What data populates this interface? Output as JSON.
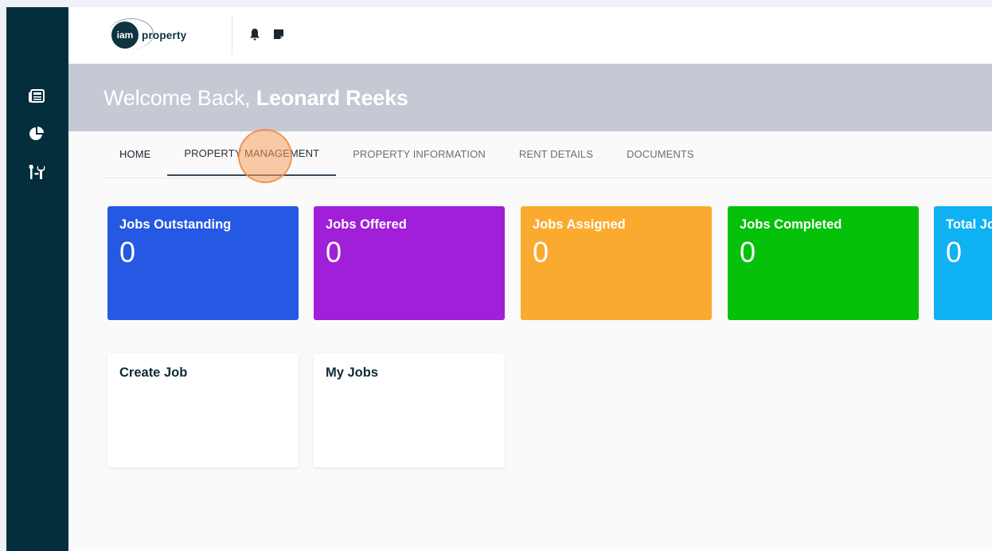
{
  "brand": {
    "logo_badge": "iam",
    "logo_word": "property"
  },
  "sidebar": {
    "items": [
      {
        "icon": "newspaper-icon"
      },
      {
        "icon": "pie-chart-icon"
      },
      {
        "icon": "tools-icon"
      }
    ],
    "bg_color": "#042e3c"
  },
  "topbar": {
    "icons": [
      "bell-icon",
      "sticky-note-icon"
    ]
  },
  "welcome": {
    "prefix": "Welcome Back, ",
    "user_name": "Leonard Reeks"
  },
  "tabs": [
    {
      "label": "HOME"
    },
    {
      "label": "PROPERTY MANAGEMENT",
      "selected": true
    },
    {
      "label": "PROPERTY INFORMATION"
    },
    {
      "label": "RENT DETAILS"
    },
    {
      "label": "DOCUMENTS"
    }
  ],
  "stats": [
    {
      "title": "Jobs Outstanding",
      "count": "0",
      "color": "#2558e3"
    },
    {
      "title": "Jobs Offered",
      "count": "0",
      "color": "#a11fd8"
    },
    {
      "title": "Jobs Assigned",
      "count": "0",
      "color": "#fbaa30"
    },
    {
      "title": "Jobs Completed",
      "count": "0",
      "color": "#06c10a"
    },
    {
      "title": "Total Jo",
      "count": "0",
      "color": "#0fb2f2"
    }
  ],
  "actions": [
    {
      "title": "Create Job"
    },
    {
      "title": "My Jobs"
    }
  ]
}
